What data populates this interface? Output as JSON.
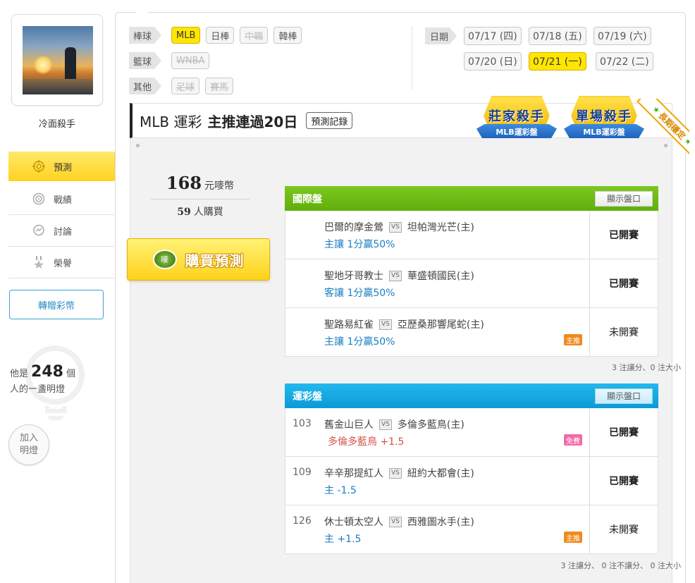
{
  "user": {
    "name": "冷面殺手"
  },
  "nav": [
    {
      "label": "預測",
      "icon": "target-icon"
    },
    {
      "label": "戰績",
      "icon": "chart-icon"
    },
    {
      "label": "討論",
      "icon": "chat-icon"
    },
    {
      "label": "榮譽",
      "icon": "medal-icon"
    }
  ],
  "transfer_label": "轉贈彩幣",
  "lamp": {
    "prefix": "他是",
    "count": "248",
    "suffix_a": "個",
    "suffix_b": "人的一盞明燈",
    "join_label": "加入明燈"
  },
  "filters": {
    "baseball": {
      "label": "棒球",
      "items": [
        "MLB",
        "日棒",
        "中職",
        "韓棒"
      ]
    },
    "basketball": {
      "label": "籃球",
      "items": [
        "WNBA"
      ]
    },
    "other": {
      "label": "其他",
      "items": [
        "足球",
        "賽馬"
      ]
    }
  },
  "dates": {
    "label": "日期",
    "items": [
      "07/17 (四)",
      "07/18 (五)",
      "07/19 (六)",
      "07/20 (日)",
      "07/21 (一)",
      "07/22 (二)"
    ],
    "active": "07/21 (一)"
  },
  "header": {
    "league": "MLB 運彩",
    "streak": "主推連過20日",
    "record_label": "預測記錄",
    "badge1_title": "莊家殺手",
    "badge1_sub": "MLB運彩盤",
    "badge2_title": "單場殺手",
    "badge2_sub": "MLB運彩盤",
    "corner_tag": "長期穩定"
  },
  "purchase": {
    "price": "168",
    "price_unit": "元嘜幣",
    "buyers": "59",
    "buyers_unit": "人購買",
    "buy_label": "購買預測",
    "coin_text": "嘜"
  },
  "intl_panel": {
    "title": "國際盤",
    "show_label": "顯示盤口",
    "games": [
      {
        "away": "巴爾的摩金鶯",
        "home": "坦帕灣光芒(主)",
        "pick": "主讓 1分贏50%",
        "status": "已開賽",
        "tag": ""
      },
      {
        "away": "聖地牙哥教士",
        "home": "華盛頓國民(主)",
        "pick": "客讓 1分贏50%",
        "status": "已開賽",
        "tag": ""
      },
      {
        "away": "聖路易紅雀",
        "home": "亞歷桑那響尾蛇(主)",
        "pick": "主讓 1分贏50%",
        "status": "未開賽",
        "tag": "主推"
      }
    ],
    "footer": "3 注讓分、0 注大小"
  },
  "sport_panel": {
    "title": "運彩盤",
    "show_label": "顯示盤口",
    "games": [
      {
        "num": "103",
        "away": "舊金山巨人",
        "home": "多倫多藍鳥(主)",
        "pick": "多倫多藍鳥 +1.5",
        "status": "已開賽",
        "tag": "免費"
      },
      {
        "num": "109",
        "away": "辛辛那提紅人",
        "home": "紐約大都會(主)",
        "pick": "主 -1.5",
        "status": "已開賽",
        "tag": ""
      },
      {
        "num": "126",
        "away": "休士頓太空人",
        "home": "西雅圖水手(主)",
        "pick": "主 +1.5",
        "status": "未開賽",
        "tag": "主推"
      }
    ],
    "footer": "3 注讓分、 0 注不讓分、 0 注大小"
  },
  "vs_text": "VS"
}
